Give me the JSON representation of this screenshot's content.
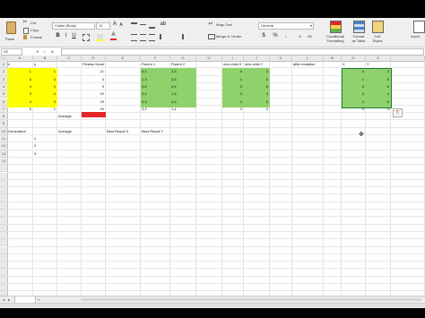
{
  "ribbon": {
    "paste_label": "Paste",
    "cut_label": "Cut",
    "copy_label": "Copy",
    "format_label": "Format",
    "font_name": "Calibri (Body)",
    "font_size": "12",
    "wrap_text_label": "Wrap Text",
    "merge_center_label": "Merge & Center",
    "number_format": "General",
    "conditional_formatting_label": "Conditional\nFormatting",
    "format_as_table_label": "Format\nas Table",
    "cell_styles_label": "Cell\nStyles",
    "insert_label": "Insert"
  },
  "formula_bar": {
    "name_box": "N2",
    "fx_label": "fx"
  },
  "columns": [
    "A",
    "B",
    "C",
    "D",
    "E",
    "F",
    "G",
    "H",
    "I",
    "J",
    "K",
    "L",
    "M",
    "N",
    "O"
  ],
  "rows": [
    "1",
    "2",
    "3",
    "4",
    "5",
    "6",
    "7",
    "8",
    "9",
    "10",
    "11",
    "12",
    "13",
    "14"
  ],
  "sheet": {
    "header_x": "x",
    "header_y": "y",
    "x_values": [
      "1",
      "5",
      "4",
      "3",
      "4",
      "6"
    ],
    "y_values": [
      "1",
      "3",
      "3",
      "4",
      "3",
      "1"
    ],
    "fitness_header": "Fitness Score",
    "fitness_values": [
      "21",
      "3",
      "9",
      "20",
      "29",
      "20"
    ],
    "parent1_header": "Parent 1",
    "parent1_values": [
      "5,4",
      "1,3",
      "3,6",
      "3,4",
      "4,3",
      "3,4"
    ],
    "parent2_header": "Parent 2",
    "parent2_values": [
      "1,5",
      "3,6",
      "3,4",
      "1,5",
      "4,5",
      "1,4"
    ],
    "new_child_x_header": "new child X",
    "new_child_y_header": "new child Y",
    "new_child_x_values": [
      "5",
      "1",
      "3",
      "3",
      "4",
      "3"
    ],
    "new_child_y_values": [
      "3",
      "5",
      "6",
      "4",
      "5",
      "4"
    ],
    "after_mutation_header": "after mutation",
    "mut_x_header": "X",
    "mut_y_header": "Y",
    "mut_x_values": [
      "4",
      "1",
      "3",
      "3",
      "4",
      "3"
    ],
    "mut_y_values": [
      "3",
      "5",
      "6",
      "4",
      "5",
      "4"
    ],
    "average_label": "Average",
    "generation_header": "Generation",
    "generation_values": [
      "1",
      "2",
      "3"
    ],
    "average_header": "Average",
    "best_x_header": "Best Result X",
    "best_y_header": "Best Result Y"
  },
  "colors": {
    "yellow": "#ffff00",
    "green": "#8fd16a",
    "red": "#e8252b",
    "selection": "#1e7b3a"
  }
}
